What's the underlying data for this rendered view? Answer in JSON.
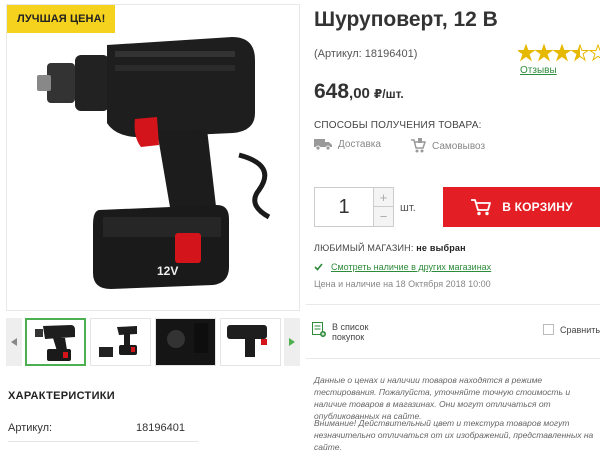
{
  "badge": "ЛУЧШАЯ ЦЕНА!",
  "product": {
    "title": "Шуруповерт, 12 В",
    "article": "(Артикул: 18196401)",
    "rating": 3.5,
    "reviews_link": "Отзывы",
    "price_main": "648",
    "price_decimals": ",00",
    "price_unit": "₽/шт."
  },
  "delivery": {
    "title": "СПОСОБЫ ПОЛУЧЕНИЯ ТОВАРА:",
    "options": [
      "Доставка",
      "Самовывоз"
    ]
  },
  "purchase": {
    "quantity": "1",
    "plus": "+",
    "minus": "−",
    "unit": "шт.",
    "cart_label": "В КОРЗИНУ"
  },
  "store": {
    "label": "ЛЮБИМЫЙ МАГАЗИН:",
    "value": "не выбран",
    "availability_link": "Смотреть наличие в других магазинах",
    "date_note": "Цена и наличие на 18 Октября 2018 10:00"
  },
  "actions": {
    "wishlist_line1": "В список",
    "wishlist_line2": "покупок",
    "compare": "Сравнить"
  },
  "notes": [
    "Данные о ценах и наличии товаров находятся в режиме тестирования. Пожалуйста, уточняйте точную стоимость и наличие товаров в магазинах. Они могут отличаться от опубликованных на сайте.",
    "Внимание! Действительный цвет и текстура товаров могут незначительно отличаться от их изображений, представленных на сайте."
  ],
  "specs": {
    "title": "ХАРАКТЕРИСТИКИ",
    "rows": [
      {
        "key": "Артикул:",
        "value": "18196401"
      }
    ]
  },
  "colors": {
    "accent_red": "#e31e24",
    "badge_yellow": "#f5d21d",
    "link_green": "#2e8b3a",
    "star_yellow": "#e6b800"
  }
}
